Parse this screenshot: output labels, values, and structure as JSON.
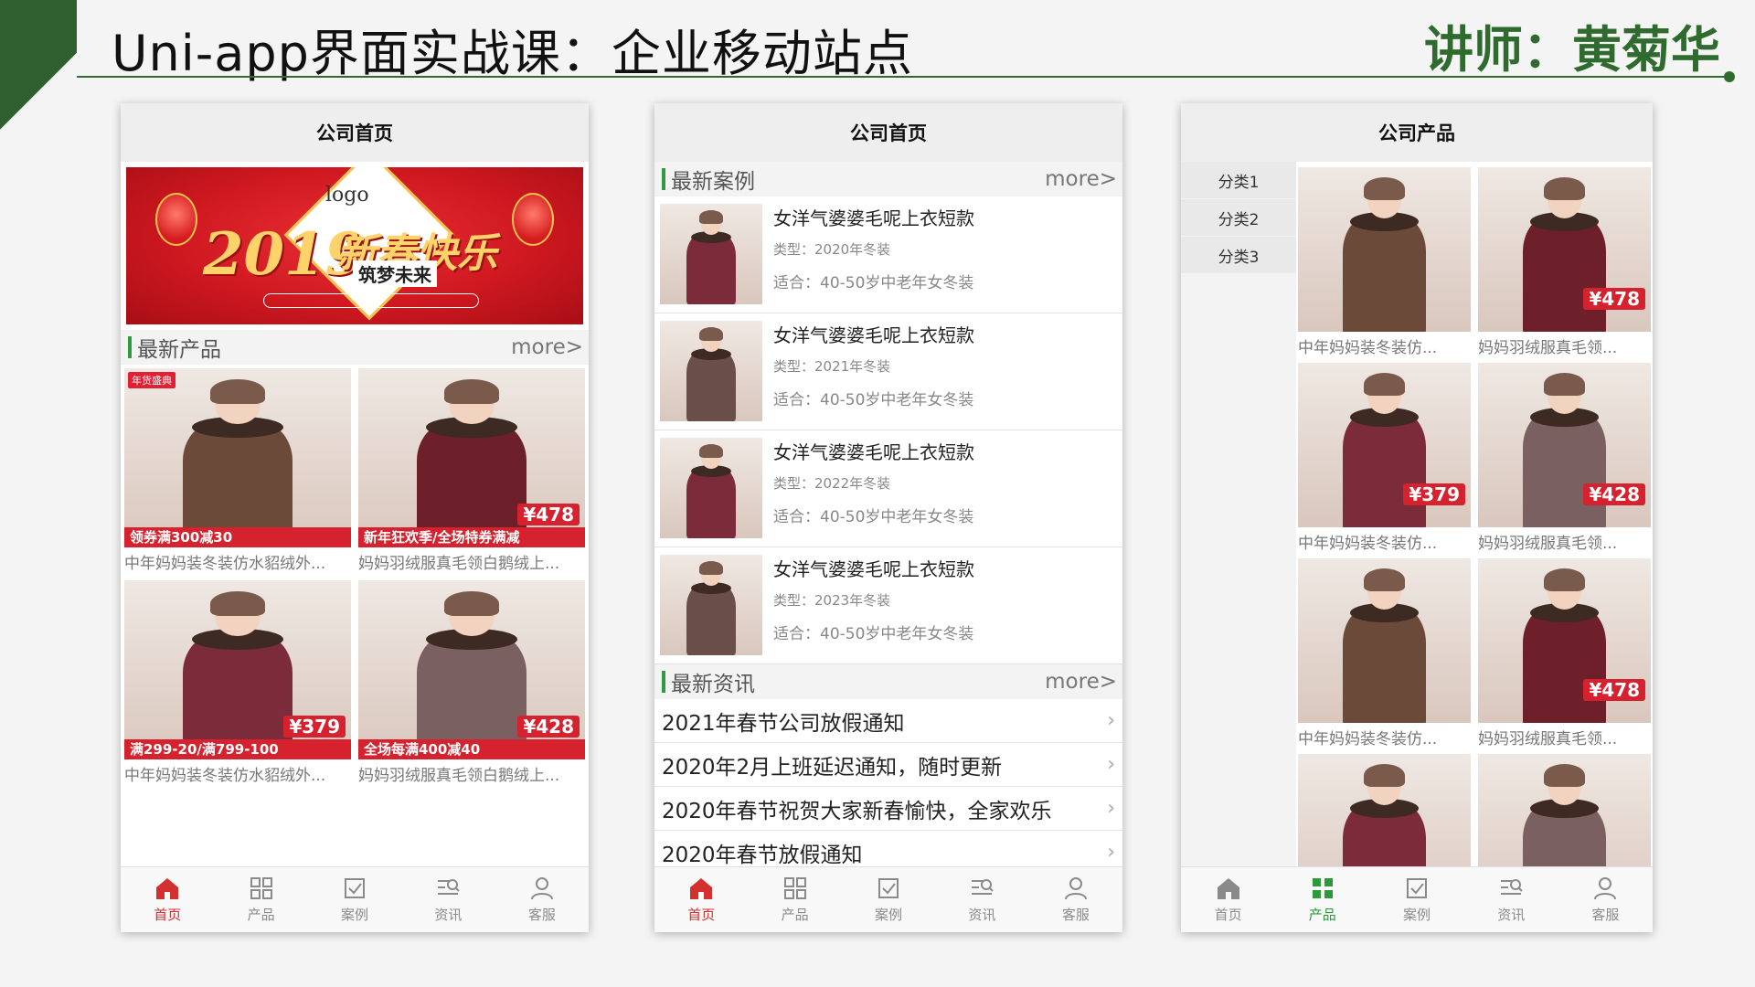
{
  "slide": {
    "title": "Uni-app界面实战课：企业移动站点",
    "lecturer": "讲师：黄菊华",
    "colors": {
      "accent": "#2f6b2f",
      "brand_red": "#d4302f",
      "active_green": "#2c9a3b"
    }
  },
  "phone1": {
    "header": "公司首页",
    "banner": {
      "logo": "logo",
      "year": "2019",
      "slogan": "新春快乐",
      "sub": "筑梦未来"
    },
    "section": {
      "title": "最新产品",
      "more": "more>"
    },
    "products": [
      {
        "caption": "中年妈妈装冬装仿水貂绒外...",
        "badge": "领券满300减30",
        "price": "",
        "coat_color": "#6b4a3a",
        "tag": "年货盛典"
      },
      {
        "caption": "妈妈羽绒服真毛领白鹅绒上...",
        "badge": "新年狂欢季/全场特券满减",
        "price": "¥478",
        "coat_color": "#6d1f2a",
        "tag": ""
      },
      {
        "caption": "中年妈妈装冬装仿水貂绒外...",
        "badge": "满299-20/满799-100",
        "price": "¥379",
        "coat_color": "#7b2b3a",
        "tag": ""
      },
      {
        "caption": "妈妈羽绒服真毛领白鹅绒上...",
        "badge": "全场每满400减40",
        "price": "¥428",
        "coat_color": "#7a6060",
        "tag": ""
      }
    ]
  },
  "phone2": {
    "header": "公司首页",
    "cases_section": {
      "title": "最新案例",
      "more": "more>"
    },
    "cases": [
      {
        "title": "女洋气婆婆毛呢上衣短款",
        "type": "类型：2020年冬装",
        "fit": "适合：40-50岁中老年女冬装"
      },
      {
        "title": "女洋气婆婆毛呢上衣短款",
        "type": "类型：2021年冬装",
        "fit": "适合：40-50岁中老年女冬装"
      },
      {
        "title": "女洋气婆婆毛呢上衣短款",
        "type": "类型：2022年冬装",
        "fit": "适合：40-50岁中老年女冬装"
      },
      {
        "title": "女洋气婆婆毛呢上衣短款",
        "type": "类型：2023年冬装",
        "fit": "适合：40-50岁中老年女冬装"
      }
    ],
    "news_section": {
      "title": "最新资讯",
      "more": "more>"
    },
    "news": [
      "2021年春节公司放假通知",
      "2020年2月上班延迟通知，随时更新",
      "2020年春节祝贺大家新春愉快，全家欢乐",
      "2020年春节放假通知"
    ]
  },
  "phone3": {
    "header": "公司产品",
    "categories": [
      "分类1",
      "分类2",
      "分类3"
    ],
    "products": [
      {
        "caption": "中年妈妈装冬装仿...",
        "price": "",
        "coat_color": "#6b4a3a"
      },
      {
        "caption": "妈妈羽绒服真毛领...",
        "price": "¥478",
        "coat_color": "#6d1f2a"
      },
      {
        "caption": "中年妈妈装冬装仿...",
        "price": "¥379",
        "coat_color": "#7b2b3a"
      },
      {
        "caption": "妈妈羽绒服真毛领...",
        "price": "¥428",
        "coat_color": "#7a6060"
      },
      {
        "caption": "中年妈妈装冬装仿...",
        "price": "",
        "coat_color": "#6b4a3a"
      },
      {
        "caption": "妈妈羽绒服真毛领...",
        "price": "¥478",
        "coat_color": "#6d1f2a"
      },
      {
        "caption": "",
        "price": "",
        "coat_color": "#7b2b3a"
      },
      {
        "caption": "",
        "price": "",
        "coat_color": "#7a6060"
      }
    ]
  },
  "tabbar": {
    "items": [
      {
        "label": "首页",
        "icon": "home-icon"
      },
      {
        "label": "产品",
        "icon": "grid-icon"
      },
      {
        "label": "案例",
        "icon": "check-square-icon"
      },
      {
        "label": "资讯",
        "icon": "news-search-icon"
      },
      {
        "label": "客服",
        "icon": "user-icon"
      }
    ]
  }
}
